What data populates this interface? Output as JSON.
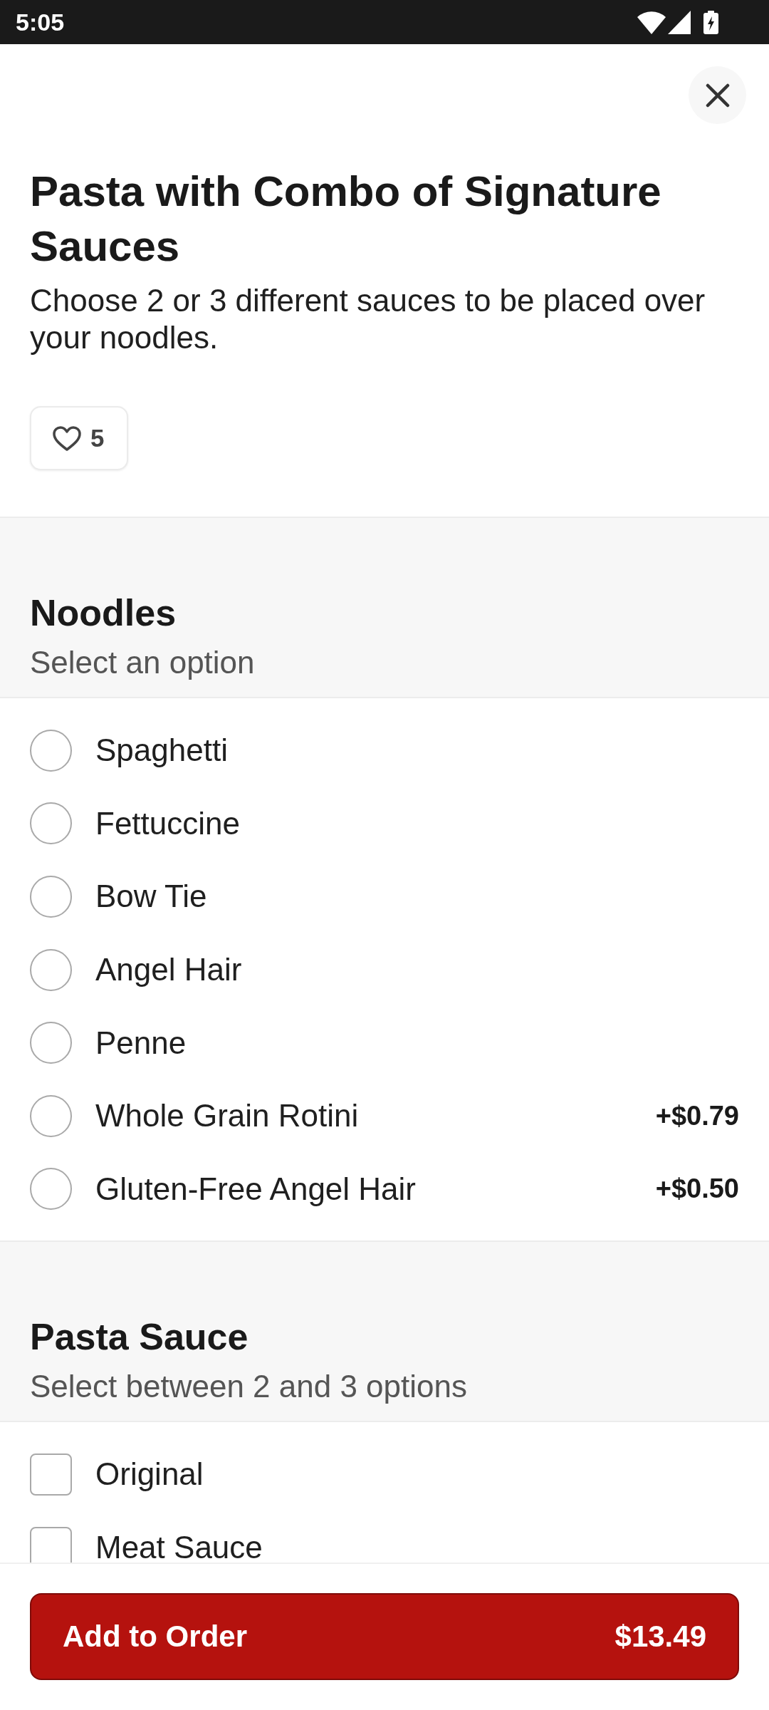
{
  "status_bar": {
    "time": "5:05"
  },
  "item": {
    "title": "Pasta with Combo of Signature Sauces",
    "description": "Choose 2 or 3 different sauces to be placed over your noodles.",
    "likes": "5",
    "liked": false
  },
  "option_groups": [
    {
      "title": "Noodles",
      "subtitle": "Select an option",
      "kind": "radio",
      "options": [
        {
          "label": "Spaghetti",
          "selected": false
        },
        {
          "label": "Fettuccine",
          "selected": false
        },
        {
          "label": "Bow Tie",
          "selected": false
        },
        {
          "label": "Angel Hair",
          "selected": false
        },
        {
          "label": "Penne",
          "selected": false
        },
        {
          "label": "Whole Grain Rotini",
          "price": "+$0.79",
          "selected": false
        },
        {
          "label": "Gluten-Free Angel Hair",
          "price": "+$0.50",
          "selected": false
        }
      ]
    },
    {
      "title": "Pasta Sauce",
      "subtitle": "Select between 2 and 3 options",
      "kind": "checkbox",
      "options": [
        {
          "label": "Original",
          "checked": false
        },
        {
          "label": "Meat Sauce",
          "checked": false
        }
      ]
    }
  ],
  "order_button": {
    "label": "Add to Order",
    "price": "$13.49"
  }
}
